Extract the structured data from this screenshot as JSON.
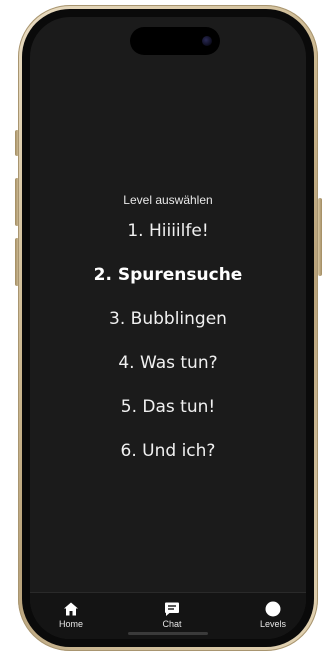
{
  "menu": {
    "heading": "Level auswählen",
    "levels": [
      {
        "label": "1. Hiiiilfe!",
        "selected": false
      },
      {
        "label": "2. Spurensuche",
        "selected": true
      },
      {
        "label": "3. Bubblingen",
        "selected": false
      },
      {
        "label": "4. Was tun?",
        "selected": false
      },
      {
        "label": "5. Das tun!",
        "selected": false
      },
      {
        "label": "6. Und ich?",
        "selected": false
      }
    ]
  },
  "tabbar": {
    "tabs": [
      {
        "label": "Home",
        "icon": "home-icon"
      },
      {
        "label": "Chat",
        "icon": "chat-icon"
      },
      {
        "label": "Levels",
        "icon": "circle-icon"
      }
    ]
  },
  "colors": {
    "screen_background": "#1b1b1b",
    "frame_gold": "#c9b58d",
    "text": "#f0f0f0"
  }
}
